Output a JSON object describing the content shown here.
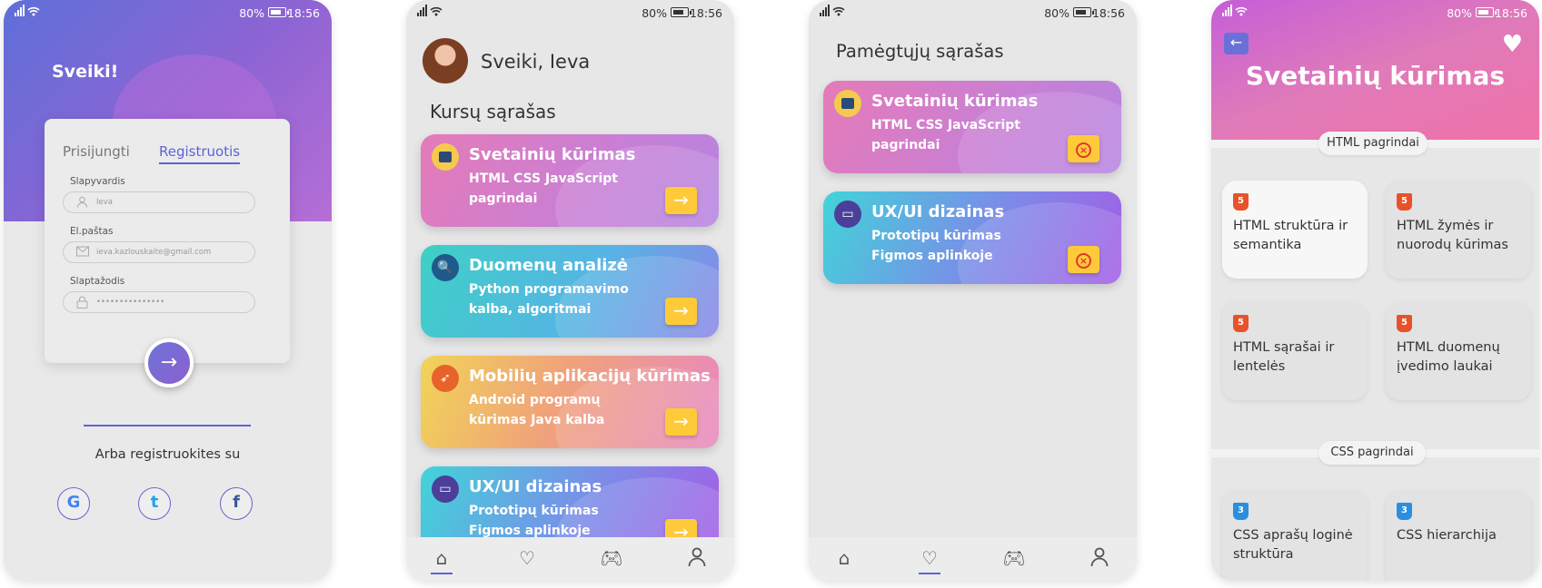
{
  "status": {
    "battery": "80%",
    "time": "18:56"
  },
  "login": {
    "greeting": "Sveiki!",
    "tab_login": "Prisijungti",
    "tab_register": "Registruotis",
    "username_label": "Slapyvardis",
    "username_value": "Ieva",
    "email_label": "El.paštas",
    "email_value": "ieva.kazlouskaite@gmail.com",
    "password_label": "Slaptažodis",
    "password_value": "•••••••••••••••",
    "or_text": "Arba registruokites su",
    "social": [
      "G",
      "t",
      "f"
    ]
  },
  "home": {
    "greeting": "Sveiki, Ieva",
    "section": "Kursų sąrašas",
    "courses": [
      {
        "title": "Svetainių kūrimas",
        "subtitle": "HTML CSS JavaScript pagrindai"
      },
      {
        "title": "Duomenų analizė",
        "subtitle": "Python programavimo kalba, algoritmai"
      },
      {
        "title": "Mobilių aplikacijų kūrimas",
        "subtitle": "Android programų kūrimas Java kalba"
      },
      {
        "title": "UX/UI dizainas",
        "subtitle": "Prototipų kūrimas Figmos aplinkoje"
      }
    ]
  },
  "favorites": {
    "section": "Pamėgtųjų sąrašas",
    "courses": [
      {
        "title": "Svetainių kūrimas",
        "subtitle": "HTML CSS JavaScript pagrindai"
      },
      {
        "title": "UX/UI dizainas",
        "subtitle": "Prototipų kūrimas Figmos aplinkoje"
      }
    ]
  },
  "detail": {
    "title": "Svetainių kūrimas",
    "section_html": "HTML pagrindai",
    "html_lessons": [
      "HTML struktūra ir semantika",
      "HTML žymės ir nuorodų kūrimas",
      "HTML sąrašai ir lentelės",
      "HTML duomenų įvedimo laukai"
    ],
    "section_css": "CSS pagrindai",
    "css_lessons": [
      "CSS aprašų loginė struktūra",
      "CSS hierarchija"
    ],
    "html_badge": "5",
    "css_badge": "3"
  },
  "colors": {
    "accent": "#5b63d6",
    "button": "#ffca3a"
  }
}
